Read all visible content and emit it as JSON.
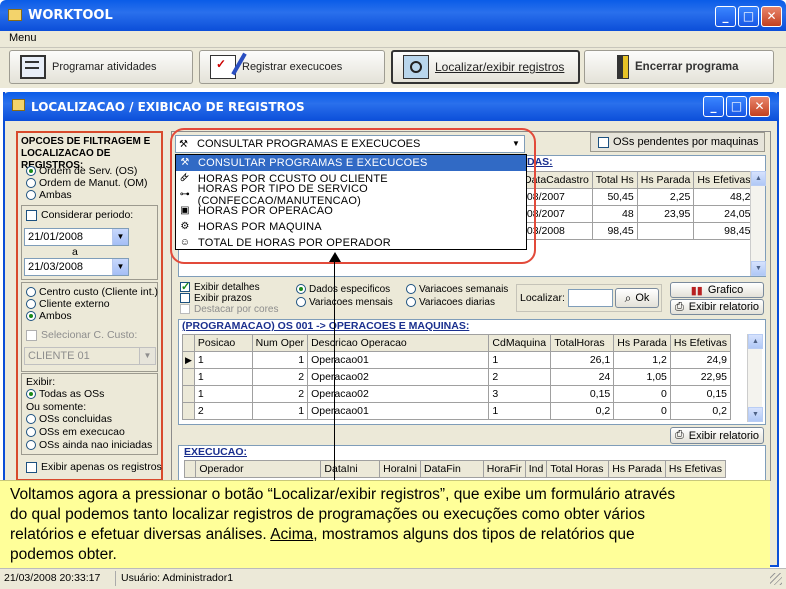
{
  "app": {
    "title": "WORKTOOL",
    "menu": "Menu"
  },
  "toolbar": {
    "btn1": "Programar atividades",
    "btn2": "Registrar execucoes",
    "btn3": "Localizar/exibir registros",
    "btn4": "Encerrar programa"
  },
  "window": {
    "title": "LOCALIZACAO / EXIBICAO DE REGISTROS"
  },
  "filters": {
    "heading": "OPCOES DE FILTRAGEM E LOCALIZACAO DE REGISTROS:",
    "order_options": [
      "Ordem de Serv. (OS)",
      "Ordem de Manut. (OM)",
      "Ambas"
    ],
    "consider_period": "Considerar periodo:",
    "date_from": "21/01/2008",
    "date_sep": "a",
    "date_to": "21/03/2008",
    "cost_options": [
      "Centro custo (Cliente int.)",
      "Cliente externo",
      "Ambos"
    ],
    "select_cost": "Selecionar C. Custo:",
    "client_value": "CLIENTE 01",
    "show_label": "Exibir:",
    "show_all": "Todas as OSs",
    "or_only": "Ou somente:",
    "only_options": [
      "OSs concluidas",
      "OSs em execucao",
      "OSs ainda nao iniciadas"
    ],
    "only_records": "Exibir apenas os registros"
  },
  "query": {
    "selected": "CONSULTAR PROGRAMAS E EXECUCOES",
    "pending": "OSs pendentes por maquinas",
    "options": [
      "CONSULTAR PROGRAMAS E EXECUCOES",
      "HORAS POR CCUSTO OU CLIENTE",
      "HORAS POR TIPO DE SERVICO (CONFECCAO/MANUTENCAO)",
      "HORAS POR OPERACAO",
      "HORAS POR MAQUINA",
      "TOTAL DE HORAS POR OPERADOR"
    ]
  },
  "top_grid": {
    "caption": "DAS:",
    "headers": [
      "DataCadastro",
      "Total Hs",
      "Hs Parada",
      "Hs Efetivas"
    ],
    "rows": [
      [
        "/08/2007",
        "50,45",
        "2,25",
        "48,2"
      ],
      [
        "/08/2007",
        "48",
        "23,95",
        "24,05"
      ],
      [
        "/03/2008",
        "98,45",
        "",
        "98,45"
      ]
    ]
  },
  "options_row": {
    "show_details": "Exibir detalhes",
    "show_deadlines": "Exibir prazos",
    "highlight": "Destacar por cores",
    "radio": [
      "Dados especificos",
      "Variacoes semanais",
      "Variacoes mensais",
      "Variacoes diarias"
    ],
    "locate": "Localizar:",
    "ok": "Ok",
    "chart": "Grafico",
    "report": "Exibir relatorio"
  },
  "prog_grid": {
    "caption": "(PROGRAMACAO) OS 001 -> OPERACOES E MAQUINAS:",
    "headers": [
      "Posicao",
      "Num Oper",
      "Descricao Operacao",
      "CdMaquina",
      "TotalHoras",
      "Hs Parada",
      "Hs Efetivas"
    ],
    "rows": [
      [
        "1",
        "1",
        "Operacao01",
        "1",
        "26,1",
        "1,2",
        "24,9"
      ],
      [
        "1",
        "2",
        "Operacao02",
        "2",
        "24",
        "1,05",
        "22,95"
      ],
      [
        "1",
        "2",
        "Operacao02",
        "3",
        "0,15",
        "0",
        "0,15"
      ],
      [
        "2",
        "1",
        "Operacao01",
        "1",
        "0,2",
        "0",
        "0,2"
      ]
    ],
    "report": "Exibir relatorio"
  },
  "exec_grid": {
    "caption": "EXECUCAO:",
    "headers": [
      "Operador",
      "DataIni",
      "HoraIni",
      "DataFin",
      "HoraFir",
      "Ind",
      "Total Horas",
      "Hs Parada",
      "Hs Efetivas"
    ]
  },
  "note": {
    "line1": "Voltamos agora a pressionar o botão “Localizar/exibir registros”, que exibe um formulário através",
    "line2": "do qual podemos tanto localizar registros de programações ou execuções como obter vários",
    "line3a": "relatórios e efetuar diversas análises. ",
    "line3b": "Acima",
    "line3c": ", mostramos alguns dos tipos de relatórios que",
    "line4": "podemos obter."
  },
  "status": {
    "datetime": "21/03/2008 20:33:17",
    "user": "Usuário: Administrador1"
  }
}
